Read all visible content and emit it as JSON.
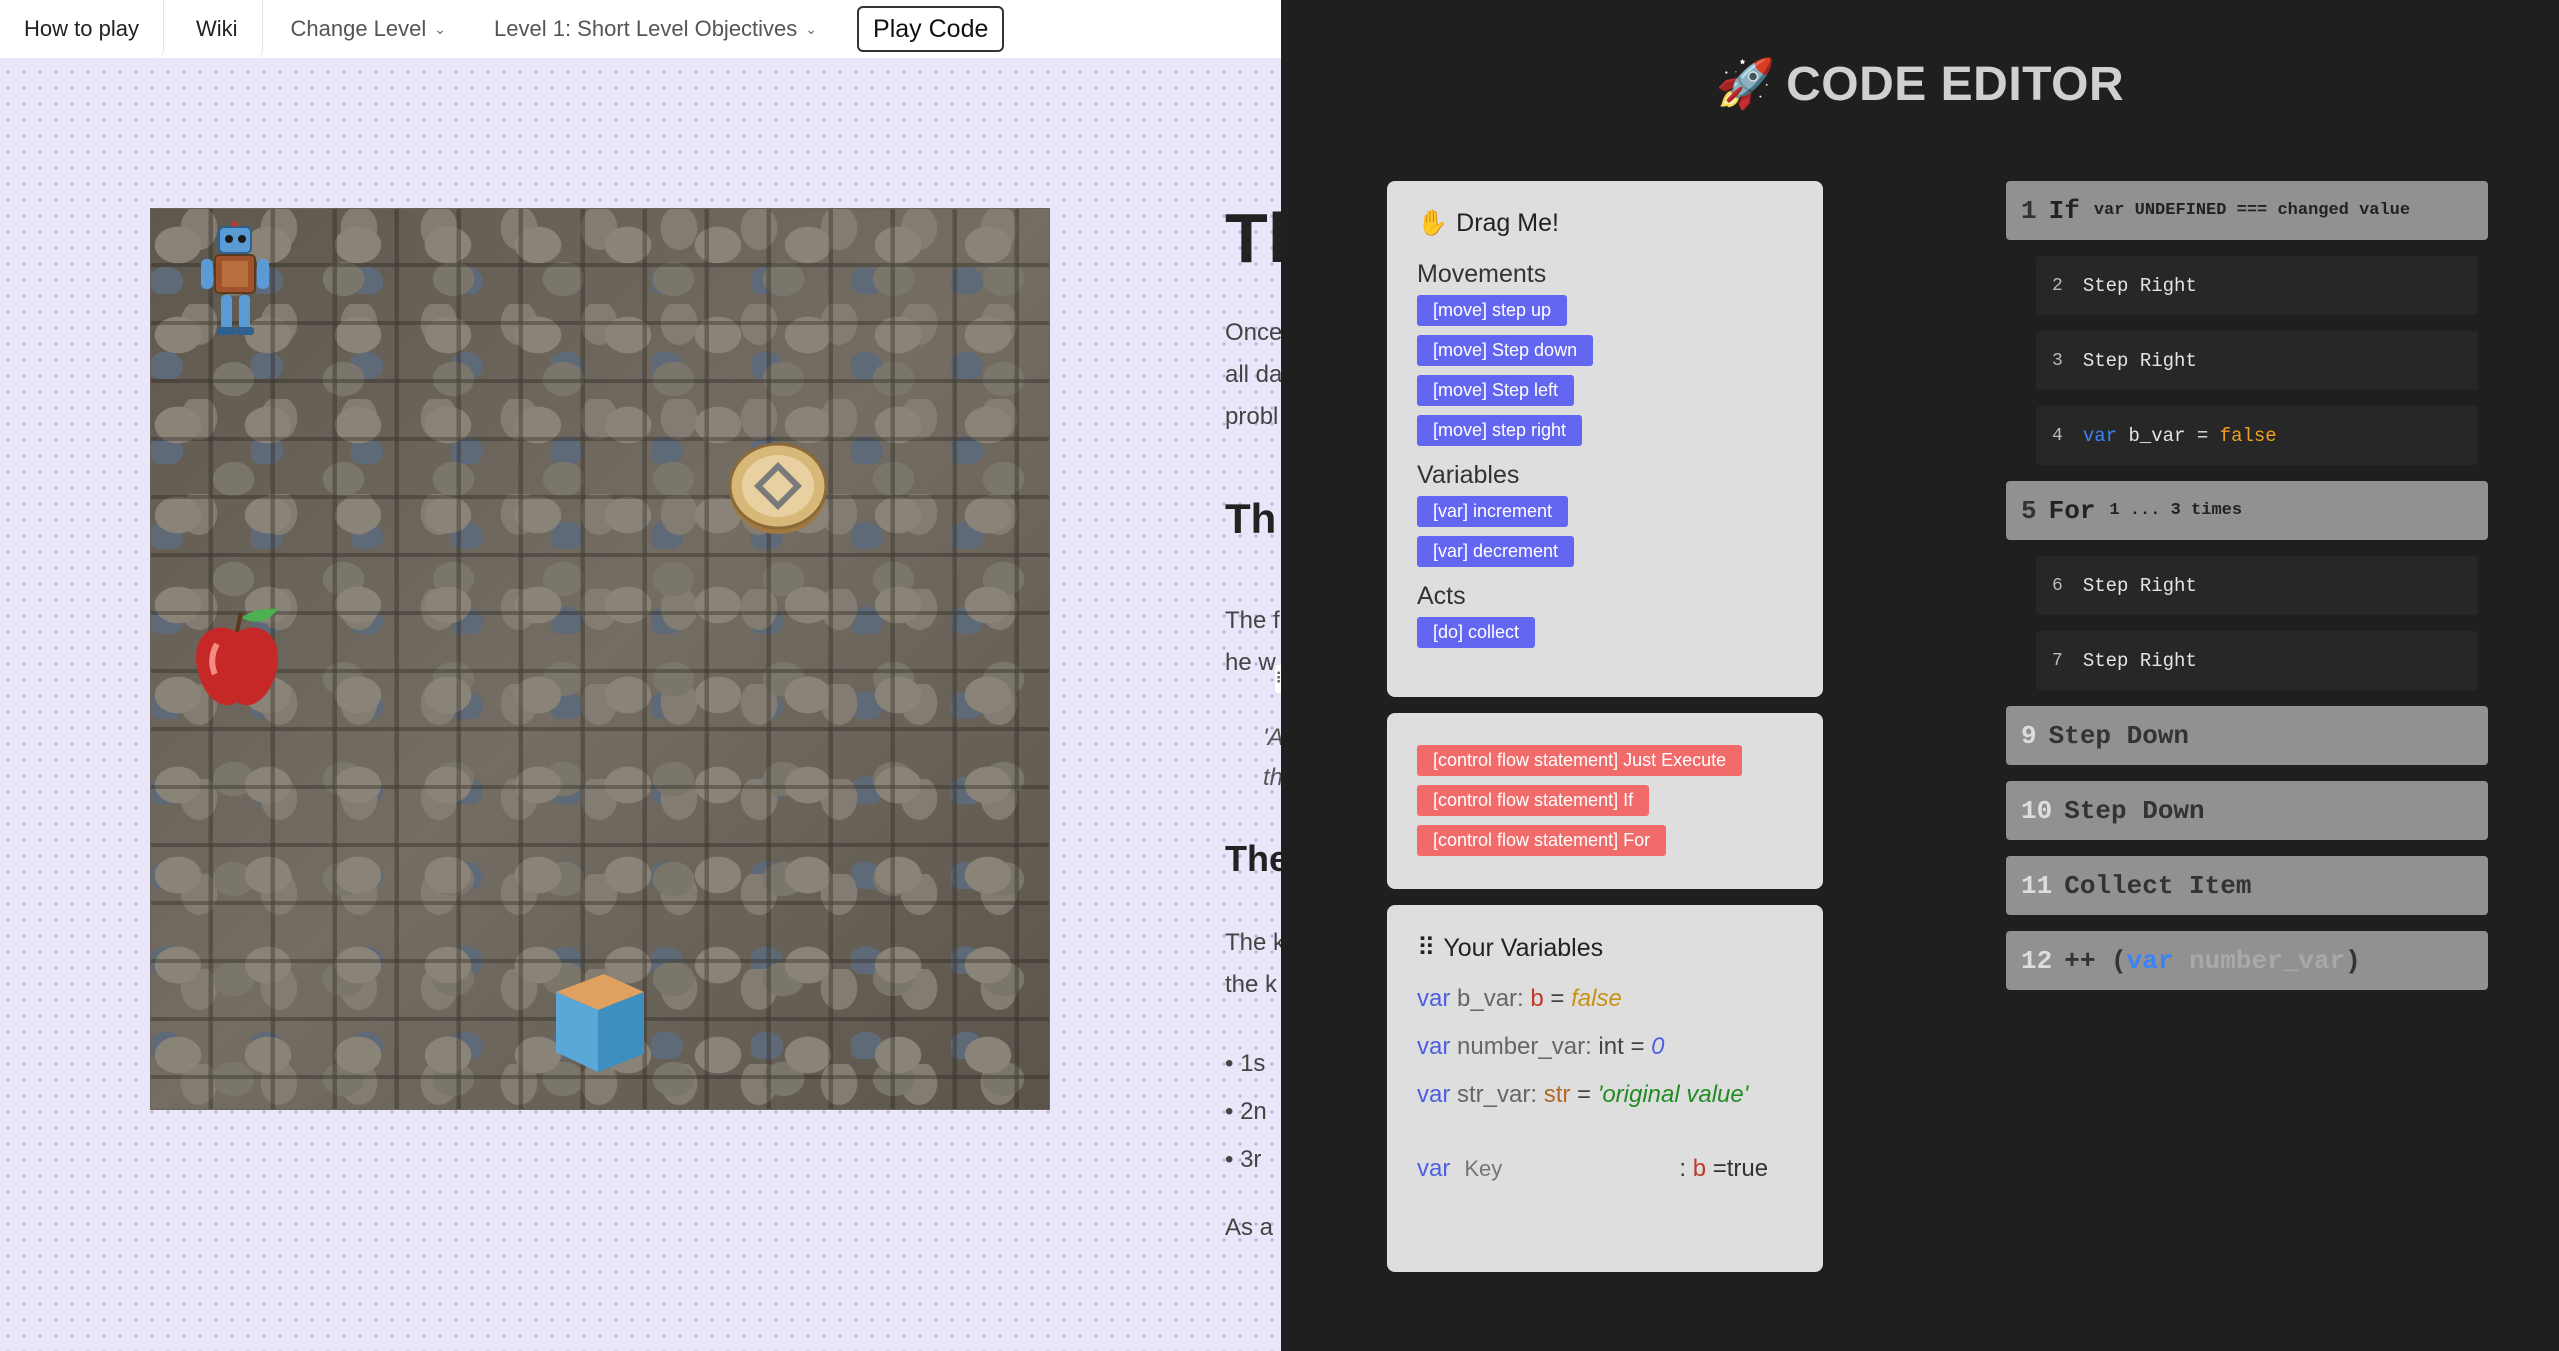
{
  "nav": {
    "how_to_play": "How to play",
    "wiki": "Wiki",
    "change_level": "Change Level",
    "level_select": "Level 1: Short Level Objectives",
    "play_code": "Play Code"
  },
  "article": {
    "heading1": "Th",
    "para1_l1": "Once",
    "para1_l2": "all da",
    "para1_l3": "probl",
    "heading2": "Th",
    "para2_l1": "The f",
    "para2_l2": "he w",
    "quote_l1": "'A",
    "quote_l2": "th",
    "heading3": "The",
    "para3_l1": "The k",
    "para3_l2": "the k",
    "li1": "1s",
    "li2": "2n",
    "li3": "3r",
    "para4": "As a"
  },
  "editor": {
    "title": "CODE EDITOR",
    "rocket_icon": "rocket-icon"
  },
  "palette": {
    "title": "Drag Me!",
    "groups": [
      {
        "name": "Movements",
        "items": [
          "[move] step up",
          "[move] Step down",
          "[move] Step left",
          "[move] step right"
        ]
      },
      {
        "name": "Variables",
        "items": [
          "[var] increment",
          "[var] decrement"
        ]
      },
      {
        "name": "Acts",
        "items": [
          "[do] collect"
        ]
      }
    ]
  },
  "control_flow": [
    "[control flow statement] Just Execute",
    "[control flow statement] If",
    "[control flow statement] For"
  ],
  "variables": {
    "title": "Your Variables",
    "list": [
      {
        "kw": "var",
        "name": "b_var:",
        "type": "b",
        "eq": "=",
        "value": "false"
      },
      {
        "kw": "var",
        "name": "number_var:",
        "type": "int",
        "eq": "=",
        "value": "0"
      },
      {
        "kw": "var",
        "name": "str_var:",
        "type": "str",
        "eq": "=",
        "value": "'original value'"
      }
    ],
    "new": {
      "kw": "var",
      "placeholder": "Key",
      "colon": ":",
      "type": "b",
      "rest": "=true"
    }
  },
  "code": {
    "l1": {
      "num": "1",
      "head": "If",
      "detail": "var UNDEFINED === changed value"
    },
    "l2": {
      "num": "2",
      "text": "Step Right"
    },
    "l3": {
      "num": "3",
      "text": "Step Right"
    },
    "l4": {
      "num": "4",
      "kw": "var",
      "name": "b_var",
      "eq": "=",
      "value": "false"
    },
    "l5": {
      "num": "5",
      "head": "For",
      "detail": "1 ... 3 times"
    },
    "l6": {
      "num": "6",
      "text": "Step Right"
    },
    "l7": {
      "num": "7",
      "text": "Step Right"
    },
    "l9": {
      "num": "9",
      "text": "Step Down"
    },
    "l10": {
      "num": "10",
      "text": "Step Down"
    },
    "l11": {
      "num": "11",
      "text": "Collect Item"
    },
    "l12": {
      "num": "12",
      "op": "++",
      "open": "(",
      "kw": "var",
      "name": "number_var",
      "close": ")"
    }
  },
  "colors": {
    "chip_blue": "#6366f1",
    "chip_red": "#f26b6b",
    "editor_bg": "#1f1f1f"
  }
}
